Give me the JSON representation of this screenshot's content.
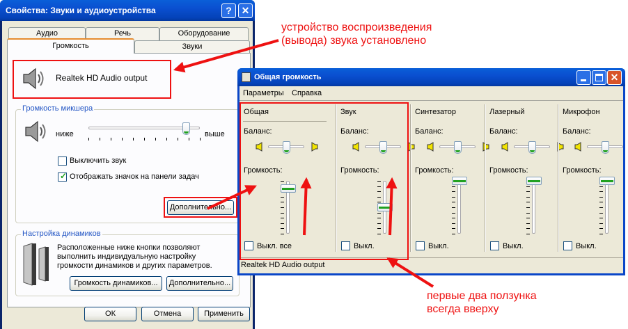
{
  "properties_window": {
    "title": "Свойства: Звуки и аудиоустройства",
    "help_glyph": "?",
    "close_glyph": "✕",
    "tabs": [
      {
        "label": "Аудио"
      },
      {
        "label": "Речь"
      },
      {
        "label": "Оборудование"
      },
      {
        "label": "Громкость"
      },
      {
        "label": "Звуки"
      }
    ],
    "active_tab": "Громкость",
    "device_name": "Realtek HD Audio output",
    "mixer_group": {
      "legend": "Громкость микшера",
      "low_label": "ниже",
      "high_label": "выше",
      "volume_level": 0.88,
      "mute_label": "Выключить звук",
      "mute_checked": false,
      "taskbar_label": "Отображать значок на панели задач",
      "taskbar_checked": true,
      "advanced_button": "Дополнительно..."
    },
    "speaker_group": {
      "legend": "Настройка динамиков",
      "description_lines": [
        "Расположенные ниже кнопки позволяют",
        "выполнить индивидуальную настройку",
        "громкости динамиков и других параметров."
      ],
      "speaker_volume_button": "Громкость динамиков...",
      "advanced_button": "Дополнительно..."
    },
    "buttons": {
      "ok": "ОК",
      "cancel": "Отмена",
      "apply": "Применить"
    }
  },
  "mixer_window": {
    "title": "Общая громкость",
    "menu": [
      "Параметры",
      "Справка"
    ],
    "balance_label": "Баланс:",
    "volume_label": "Громкость:",
    "columns": [
      {
        "name": "Общая",
        "mute_label": "Выкл. все",
        "volume": 0.85,
        "balance": 0.5,
        "muted": false
      },
      {
        "name": "Звук",
        "mute_label": "Выкл.",
        "volume": 0.5,
        "balance": 0.5,
        "muted": false
      },
      {
        "name": "Синтезатор",
        "mute_label": "Выкл.",
        "volume": 1.0,
        "balance": 0.5,
        "muted": false
      },
      {
        "name": "Лазерный",
        "mute_label": "Выкл.",
        "volume": 1.0,
        "balance": 0.5,
        "muted": false
      },
      {
        "name": "Микрофон",
        "mute_label": "Выкл.",
        "volume": 1.0,
        "balance": 0.5,
        "muted": false
      }
    ],
    "status": "Realtek HD Audio output"
  },
  "annotations": {
    "device_note": [
      "устройство воспроизведения",
      "(вывода) звука установлено"
    ],
    "sliders_note": [
      "первые два ползунка",
      "всегда вверху"
    ],
    "color": "#ee1111"
  }
}
